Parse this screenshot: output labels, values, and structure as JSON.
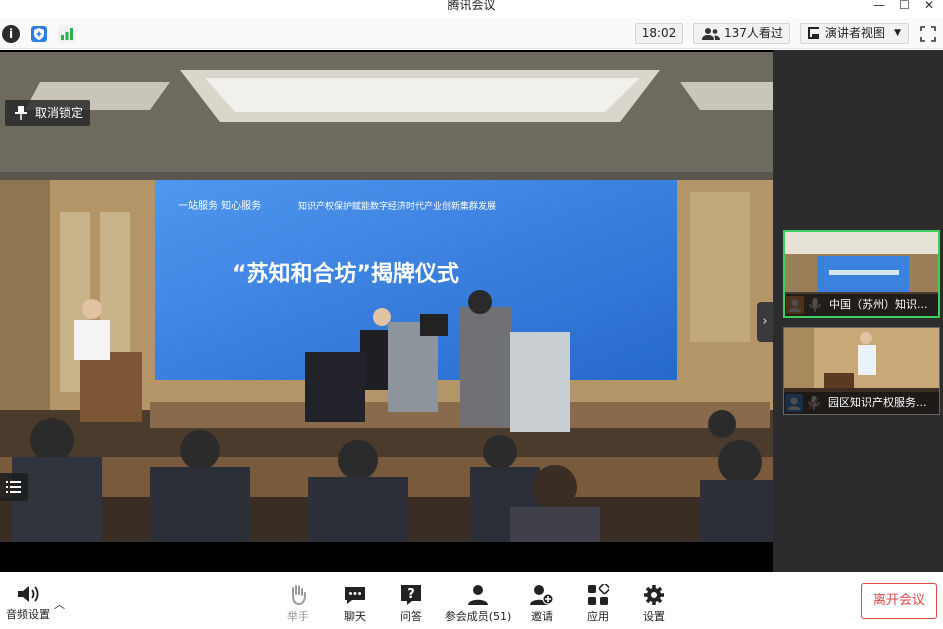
{
  "window": {
    "title": "腾讯会议"
  },
  "topbar": {
    "time": "18:02",
    "viewers": "137人看过",
    "view_mode": "演讲者视图"
  },
  "main_video": {
    "unpin_label": "取消锁定",
    "banner_title": "“苏知和合坊”揭牌仪式",
    "banner_subtitle": "知识产权保护赋能数字经济时代产业创新集群发展",
    "banner_logo": "一站服务 知心服务"
  },
  "participants": [
    {
      "name": "中国（苏州）知识...",
      "avatar_color": "#f08a24",
      "active": true
    },
    {
      "name": "园区知识产权服务...",
      "avatar_color": "#2f7de1",
      "active": false
    }
  ],
  "toolbar": {
    "audio_label": "音频设置",
    "raise_hand_label": "举手",
    "chat_label": "聊天",
    "qa_label": "问答",
    "members_label": "参会成员(51)",
    "invite_label": "邀请",
    "apps_label": "应用",
    "settings_label": "设置",
    "leave_label": "离开会议"
  },
  "colors": {
    "leave": "#e04848",
    "active_border": "#3fcf5c",
    "signal": "#2bb24c",
    "shield": "#2f7de1"
  }
}
